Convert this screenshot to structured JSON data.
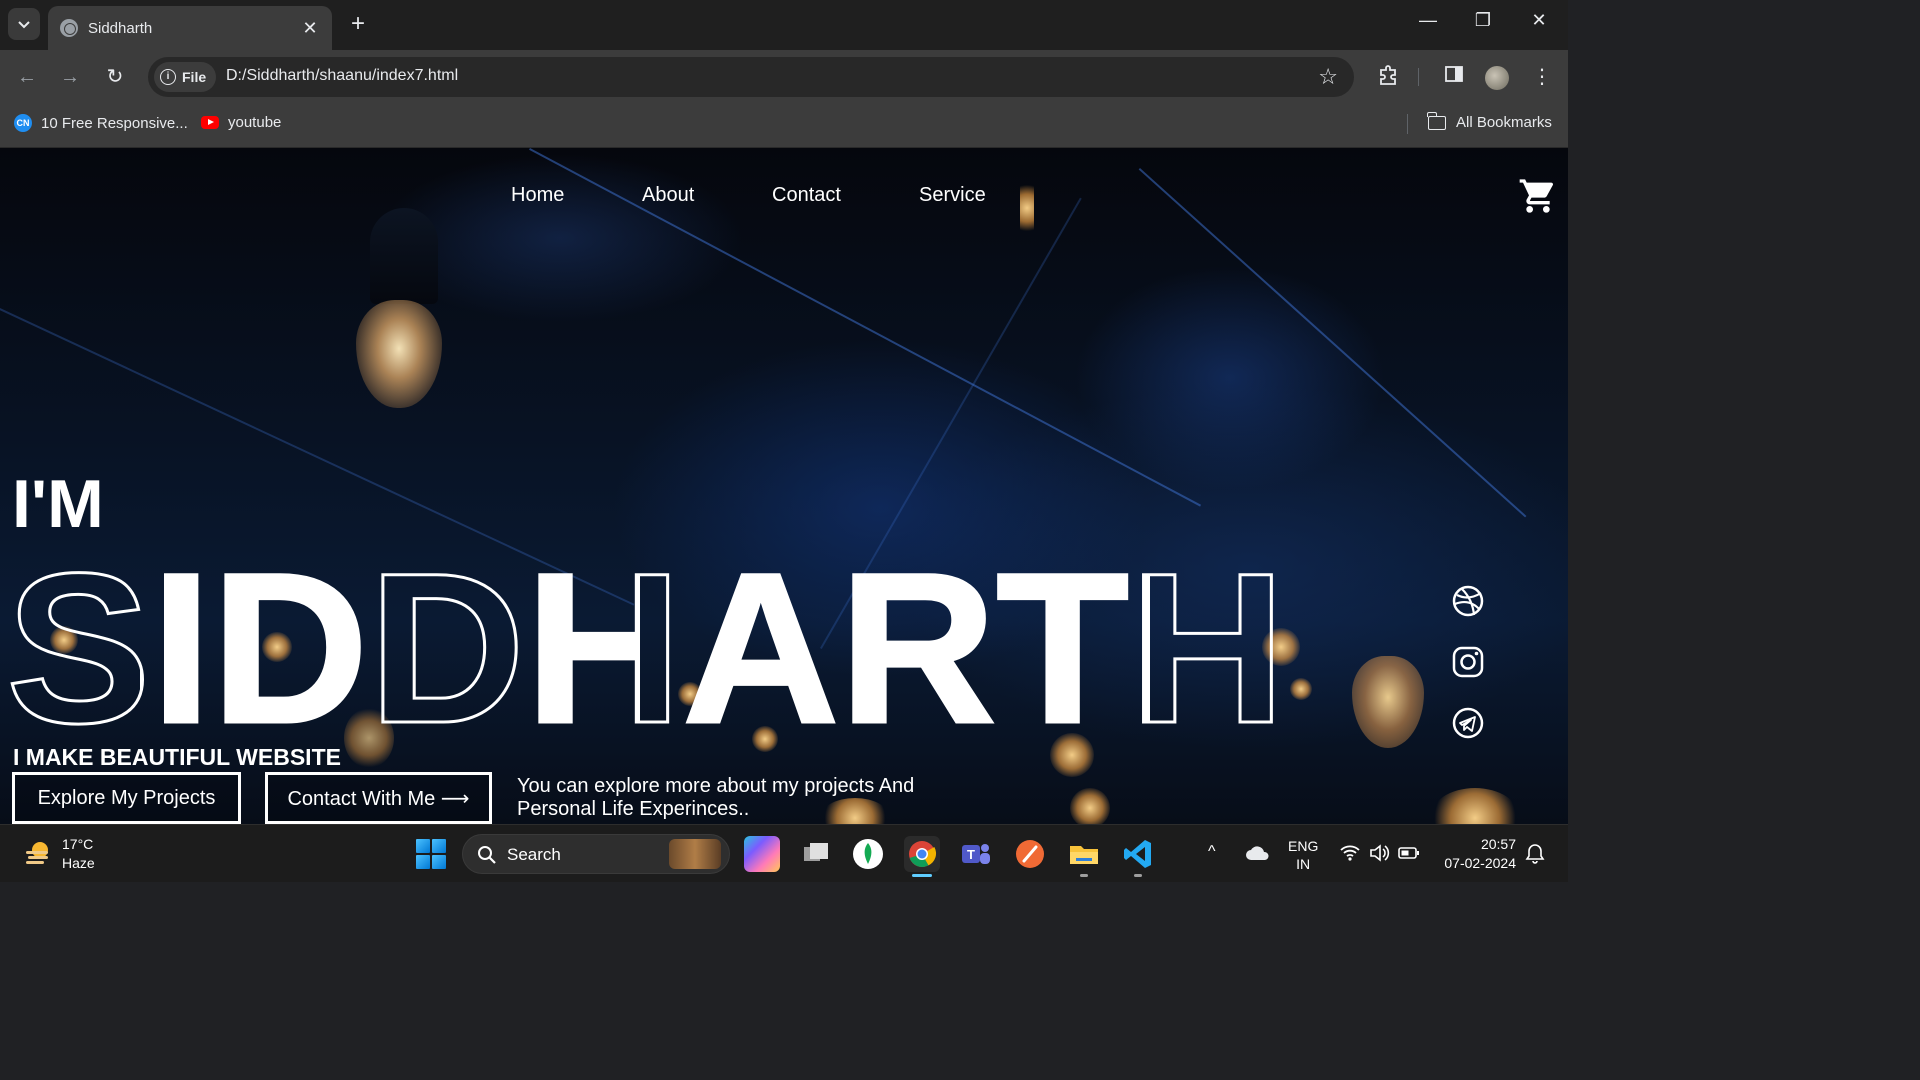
{
  "browser": {
    "tab_title": "Siddharth",
    "chip_label": "File",
    "url": "D:/Siddharth/shaanu/index7.html",
    "bookmarks": [
      {
        "label": "10 Free Responsive...",
        "icon": "codepen-favicon-icon"
      },
      {
        "label": "youtube",
        "icon": "youtube-icon"
      }
    ],
    "all_bookmarks": "All Bookmarks"
  },
  "site": {
    "nav": [
      "Home",
      "About",
      "Contact",
      "Service"
    ],
    "intro": "I'M",
    "name": "SIDDHARTH",
    "tagline": "I MAKE BEAUTIFUL WEBSITE",
    "buttons": {
      "explore": "Explore My Projects",
      "contact": "Contact With Me ⟶"
    },
    "description": "You can explore more about my projects And Personal Life Experinces..",
    "social_icons": [
      "dribbble-icon",
      "instagram-icon",
      "telegram-icon"
    ]
  },
  "taskbar": {
    "weather_temp": "17°C",
    "weather_desc": "Haze",
    "search_label": "Search",
    "lang_1": "ENG",
    "lang_2": "IN",
    "time": "20:57",
    "date": "07-02-2024"
  },
  "colors": {
    "chrome_dark": "#1f1f1f",
    "chrome_toolbar": "#3c3c3c",
    "text_light": "#e8eaed",
    "page_bg": "#081325"
  }
}
